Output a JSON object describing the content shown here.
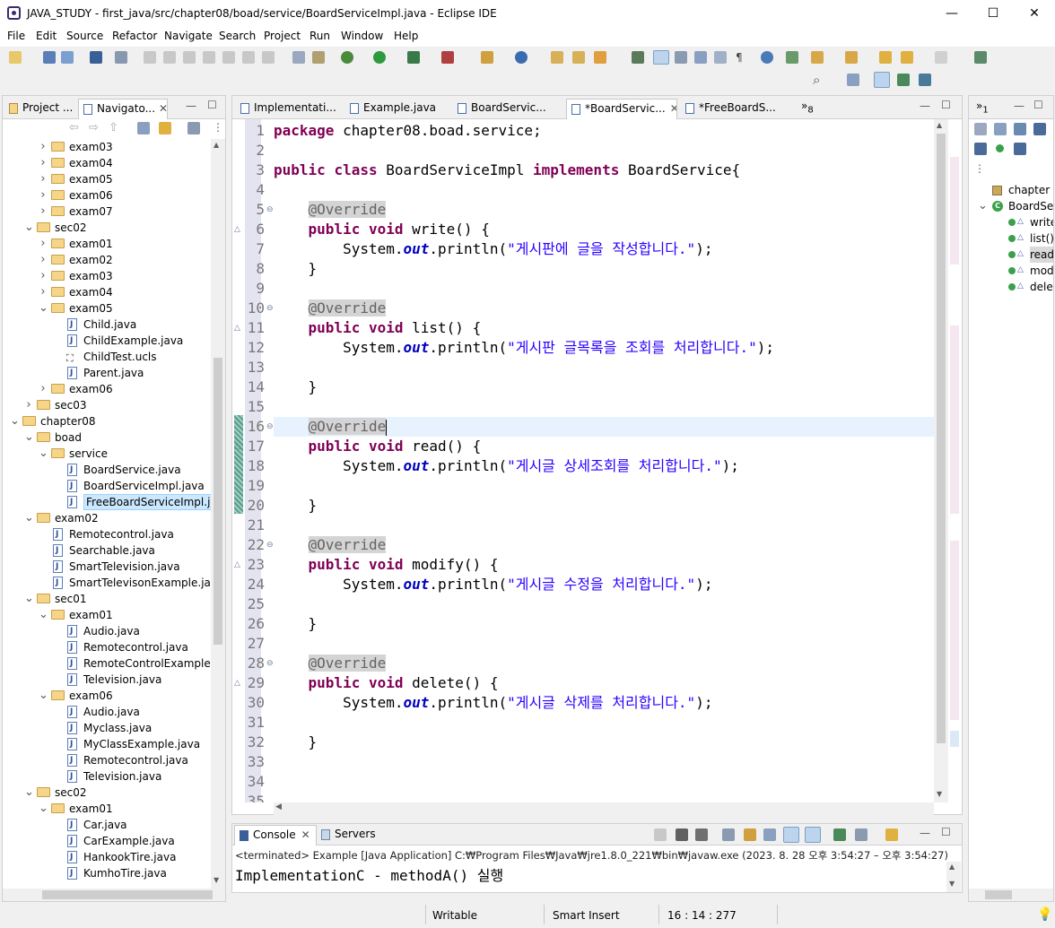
{
  "window": {
    "title": "JAVA_STUDY - first_java/src/chapter08/boad/service/BoardServiceImpl.java - Eclipse IDE",
    "minimize": "—",
    "maximize": "☐",
    "close": "✕"
  },
  "menu": [
    "File",
    "Edit",
    "Source",
    "Refactor",
    "Navigate",
    "Search",
    "Project",
    "Run",
    "Window",
    "Help"
  ],
  "left_panel": {
    "tabs": [
      "Project ...",
      "Navigato..."
    ],
    "tree": [
      {
        "label": "exam03",
        "indent": 2,
        "type": "folder",
        "state": "collapsed"
      },
      {
        "label": "exam04",
        "indent": 2,
        "type": "folder",
        "state": "collapsed"
      },
      {
        "label": "exam05",
        "indent": 2,
        "type": "folder",
        "state": "collapsed"
      },
      {
        "label": "exam06",
        "indent": 2,
        "type": "folder",
        "state": "collapsed"
      },
      {
        "label": "exam07",
        "indent": 2,
        "type": "folder",
        "state": "collapsed"
      },
      {
        "label": "sec02",
        "indent": 1,
        "type": "folder",
        "state": "expanded"
      },
      {
        "label": "exam01",
        "indent": 2,
        "type": "folder",
        "state": "collapsed"
      },
      {
        "label": "exam02",
        "indent": 2,
        "type": "folder",
        "state": "collapsed"
      },
      {
        "label": "exam03",
        "indent": 2,
        "type": "folder",
        "state": "collapsed"
      },
      {
        "label": "exam04",
        "indent": 2,
        "type": "folder",
        "state": "collapsed"
      },
      {
        "label": "exam05",
        "indent": 2,
        "type": "folder",
        "state": "expanded"
      },
      {
        "label": "Child.java",
        "indent": 3,
        "type": "java"
      },
      {
        "label": "ChildExample.java",
        "indent": 3,
        "type": "java"
      },
      {
        "label": "ChildTest.ucls",
        "indent": 3,
        "type": "ucls"
      },
      {
        "label": "Parent.java",
        "indent": 3,
        "type": "java"
      },
      {
        "label": "exam06",
        "indent": 2,
        "type": "folder",
        "state": "collapsed"
      },
      {
        "label": "sec03",
        "indent": 1,
        "type": "folder",
        "state": "collapsed"
      },
      {
        "label": "chapter08",
        "indent": 0,
        "type": "folder",
        "state": "expanded"
      },
      {
        "label": "boad",
        "indent": 1,
        "type": "folder",
        "state": "expanded"
      },
      {
        "label": "service",
        "indent": 2,
        "type": "folder",
        "state": "expanded"
      },
      {
        "label": "BoardService.java",
        "indent": 3,
        "type": "java"
      },
      {
        "label": "BoardServiceImpl.java",
        "indent": 3,
        "type": "java"
      },
      {
        "label": "FreeBoardServiceImpl.java",
        "indent": 3,
        "type": "java",
        "selected": true
      },
      {
        "label": "exam02",
        "indent": 1,
        "type": "folder",
        "state": "expanded"
      },
      {
        "label": "Remotecontrol.java",
        "indent": 2,
        "type": "java"
      },
      {
        "label": "Searchable.java",
        "indent": 2,
        "type": "java"
      },
      {
        "label": "SmartTelevision.java",
        "indent": 2,
        "type": "java"
      },
      {
        "label": "SmartTelevisonExample.java",
        "indent": 2,
        "type": "java"
      },
      {
        "label": "sec01",
        "indent": 1,
        "type": "folder",
        "state": "expanded"
      },
      {
        "label": "exam01",
        "indent": 2,
        "type": "folder",
        "state": "expanded"
      },
      {
        "label": "Audio.java",
        "indent": 3,
        "type": "java"
      },
      {
        "label": "Remotecontrol.java",
        "indent": 3,
        "type": "java"
      },
      {
        "label": "RemoteControlExample.jav",
        "indent": 3,
        "type": "java"
      },
      {
        "label": "Television.java",
        "indent": 3,
        "type": "java"
      },
      {
        "label": "exam06",
        "indent": 2,
        "type": "folder",
        "state": "expanded"
      },
      {
        "label": "Audio.java",
        "indent": 3,
        "type": "java"
      },
      {
        "label": "Myclass.java",
        "indent": 3,
        "type": "java"
      },
      {
        "label": "MyClassExample.java",
        "indent": 3,
        "type": "java"
      },
      {
        "label": "Remotecontrol.java",
        "indent": 3,
        "type": "java"
      },
      {
        "label": "Television.java",
        "indent": 3,
        "type": "java"
      },
      {
        "label": "sec02",
        "indent": 1,
        "type": "folder",
        "state": "expanded"
      },
      {
        "label": "exam01",
        "indent": 2,
        "type": "folder",
        "state": "expanded"
      },
      {
        "label": "Car.java",
        "indent": 3,
        "type": "java"
      },
      {
        "label": "CarExample.java",
        "indent": 3,
        "type": "java"
      },
      {
        "label": "HankookTire.java",
        "indent": 3,
        "type": "java"
      },
      {
        "label": "KumhoTire.java",
        "indent": 3,
        "type": "java"
      }
    ]
  },
  "editor": {
    "tabs": [
      {
        "label": "Implementati...",
        "active": false
      },
      {
        "label": "Example.java",
        "active": false
      },
      {
        "label": "BoardServic...",
        "active": false
      },
      {
        "label": "*BoardServic...",
        "active": true
      },
      {
        "label": "*FreeBoardS...",
        "active": false
      }
    ],
    "overflow_count": "8",
    "lines": [
      {
        "n": "1",
        "tokens": [
          [
            "kw",
            "package"
          ],
          [
            "",
            " chapter08.boad.service;"
          ]
        ]
      },
      {
        "n": "2",
        "tokens": []
      },
      {
        "n": "3",
        "tokens": [
          [
            "kw",
            "public"
          ],
          [
            "",
            " "
          ],
          [
            "kw",
            "class"
          ],
          [
            "",
            " BoardServiceImpl "
          ],
          [
            "kw",
            "implements"
          ],
          [
            "",
            " BoardService{"
          ]
        ]
      },
      {
        "n": "4",
        "tokens": []
      },
      {
        "n": "5",
        "tokens": [
          [
            "",
            "    "
          ],
          [
            "ann",
            "@Override"
          ]
        ],
        "fold": "minus"
      },
      {
        "n": "6",
        "tokens": [
          [
            "",
            "    "
          ],
          [
            "kw",
            "public"
          ],
          [
            "",
            " "
          ],
          [
            "kw",
            "void"
          ],
          [
            "",
            " write() {"
          ]
        ],
        "fold": "tri"
      },
      {
        "n": "7",
        "tokens": [
          [
            "",
            "        System."
          ],
          [
            "fld",
            "out"
          ],
          [
            "",
            ".println("
          ],
          [
            "str",
            "\"게시판에 글을 작성합니다.\""
          ],
          [
            "",
            ");"
          ]
        ]
      },
      {
        "n": "8",
        "tokens": [
          [
            "",
            "    }"
          ]
        ]
      },
      {
        "n": "9",
        "tokens": []
      },
      {
        "n": "10",
        "tokens": [
          [
            "",
            "    "
          ],
          [
            "ann",
            "@Override"
          ]
        ],
        "fold": "minus"
      },
      {
        "n": "11",
        "tokens": [
          [
            "",
            "    "
          ],
          [
            "kw",
            "public"
          ],
          [
            "",
            " "
          ],
          [
            "kw",
            "void"
          ],
          [
            "",
            " list() {"
          ]
        ],
        "fold": "tri"
      },
      {
        "n": "12",
        "tokens": [
          [
            "",
            "        System."
          ],
          [
            "fld",
            "out"
          ],
          [
            "",
            ".println("
          ],
          [
            "str",
            "\"게시판 글목록을 조회를 처리합니다.\""
          ],
          [
            "",
            ");"
          ]
        ]
      },
      {
        "n": "13",
        "tokens": []
      },
      {
        "n": "14",
        "tokens": [
          [
            "",
            "    }"
          ]
        ]
      },
      {
        "n": "15",
        "tokens": []
      },
      {
        "n": "16",
        "tokens": [
          [
            "",
            "    "
          ],
          [
            "ann",
            "@Override"
          ]
        ],
        "fold": "minus",
        "current": true
      },
      {
        "n": "17",
        "tokens": [
          [
            "",
            "    "
          ],
          [
            "kw",
            "public"
          ],
          [
            "",
            " "
          ],
          [
            "kw",
            "void"
          ],
          [
            "",
            " read() {"
          ]
        ],
        "fold": "tri"
      },
      {
        "n": "18",
        "tokens": [
          [
            "",
            "        System."
          ],
          [
            "fld",
            "out"
          ],
          [
            "",
            ".println("
          ],
          [
            "str",
            "\"게시글 상세조회를 처리합니다.\""
          ],
          [
            "",
            ");"
          ]
        ]
      },
      {
        "n": "19",
        "tokens": []
      },
      {
        "n": "20",
        "tokens": [
          [
            "",
            "    }"
          ]
        ]
      },
      {
        "n": "21",
        "tokens": []
      },
      {
        "n": "22",
        "tokens": [
          [
            "",
            "    "
          ],
          [
            "ann",
            "@Override"
          ]
        ],
        "fold": "minus"
      },
      {
        "n": "23",
        "tokens": [
          [
            "",
            "    "
          ],
          [
            "kw",
            "public"
          ],
          [
            "",
            " "
          ],
          [
            "kw",
            "void"
          ],
          [
            "",
            " modify() {"
          ]
        ],
        "fold": "tri"
      },
      {
        "n": "24",
        "tokens": [
          [
            "",
            "        System."
          ],
          [
            "fld",
            "out"
          ],
          [
            "",
            ".println("
          ],
          [
            "str",
            "\"게시글 수정을 처리합니다.\""
          ],
          [
            "",
            ");"
          ]
        ]
      },
      {
        "n": "25",
        "tokens": []
      },
      {
        "n": "26",
        "tokens": [
          [
            "",
            "    }"
          ]
        ]
      },
      {
        "n": "27",
        "tokens": []
      },
      {
        "n": "28",
        "tokens": [
          [
            "",
            "    "
          ],
          [
            "ann",
            "@Override"
          ]
        ],
        "fold": "minus"
      },
      {
        "n": "29",
        "tokens": [
          [
            "",
            "    "
          ],
          [
            "kw",
            "public"
          ],
          [
            "",
            " "
          ],
          [
            "kw",
            "void"
          ],
          [
            "",
            " delete() {"
          ]
        ],
        "fold": "tri"
      },
      {
        "n": "30",
        "tokens": [
          [
            "",
            "        System."
          ],
          [
            "fld",
            "out"
          ],
          [
            "",
            ".println("
          ],
          [
            "str",
            "\"게시글 삭제를 처리합니다.\""
          ],
          [
            "",
            ");"
          ]
        ]
      },
      {
        "n": "31",
        "tokens": []
      },
      {
        "n": "32",
        "tokens": [
          [
            "",
            "    }"
          ]
        ]
      },
      {
        "n": "33",
        "tokens": []
      },
      {
        "n": "34",
        "tokens": []
      },
      {
        "n": "35",
        "tokens": []
      }
    ]
  },
  "outline": {
    "items": [
      {
        "label": "chapter",
        "kind": "package"
      },
      {
        "label": "BoardSe",
        "kind": "class"
      },
      {
        "label": "write",
        "kind": "method"
      },
      {
        "label": "list()",
        "kind": "method"
      },
      {
        "label": "read",
        "kind": "method",
        "selected": true
      },
      {
        "label": "mod",
        "kind": "method"
      },
      {
        "label": "delet",
        "kind": "method"
      }
    ],
    "tab_count": "1"
  },
  "console": {
    "tabs": [
      "Console",
      "Servers"
    ],
    "status": "<terminated> Example [Java Application] C:₩Program Files₩Java₩jre1.8.0_221₩bin₩javaw.exe  (2023. 8. 28 오후 3:54:27 – 오후 3:54:27)",
    "output": "ImplementationC - methodA() 실행"
  },
  "statusbar": {
    "mode": "Writable",
    "insert": "Smart Insert",
    "position": "16 : 14 : 277"
  },
  "colors": {
    "keyword": "#7f0055",
    "string": "#2a00ff",
    "field": "#0000c0",
    "annotation_bg": "#d4d4d4",
    "current_line": "#e8f2fe",
    "selection": "#cce8ff"
  }
}
